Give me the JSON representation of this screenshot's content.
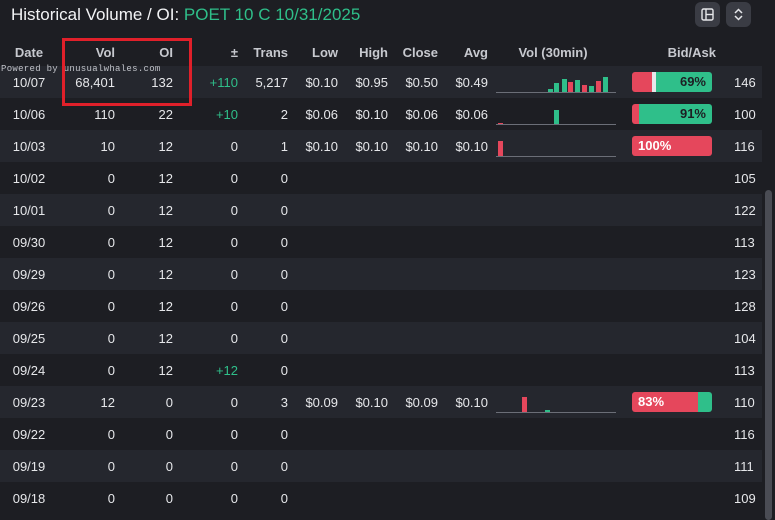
{
  "header": {
    "title_prefix": "Historical Volume / OI: ",
    "title_contract": "POET 10 C 10/31/2025",
    "buttons": [
      "columns-icon",
      "expand-collapse-icon"
    ]
  },
  "watermark": "Powered by unusualwhales.com",
  "columns": [
    "Date",
    "Vol",
    "OI",
    "±",
    "Trans",
    "Low",
    "High",
    "Close",
    "Avg",
    "Vol (30min)",
    "Bid/Ask",
    ""
  ],
  "rows": [
    {
      "date": "10/07",
      "vol": "68,401",
      "oi": "132",
      "chg": "+110",
      "trans": "5,217",
      "low": "$0.10",
      "high": "$0.95",
      "close": "$0.50",
      "avg": "$0.49",
      "spark": [
        {
          "pos": 0.45,
          "h": 0.12,
          "c": "g"
        },
        {
          "pos": 0.5,
          "h": 0.45,
          "c": "g"
        },
        {
          "pos": 0.57,
          "h": 0.65,
          "c": "g"
        },
        {
          "pos": 0.63,
          "h": 0.5,
          "c": "rd"
        },
        {
          "pos": 0.69,
          "h": 0.6,
          "c": "g"
        },
        {
          "pos": 0.75,
          "h": 0.35,
          "c": "rd"
        },
        {
          "pos": 0.81,
          "h": 0.3,
          "c": "g"
        },
        {
          "pos": 0.87,
          "h": 0.55,
          "c": "rd"
        },
        {
          "pos": 0.93,
          "h": 0.75,
          "c": "g"
        }
      ],
      "bid": 0.25,
      "mid": 0.05,
      "ask": 0.7,
      "label": "69%",
      "label_side": "ask",
      "extra": "146"
    },
    {
      "date": "10/06",
      "vol": "110",
      "oi": "22",
      "chg": "+10",
      "trans": "2",
      "low": "$0.06",
      "high": "$0.10",
      "close": "$0.06",
      "avg": "$0.06",
      "spark": [
        {
          "pos": 0.02,
          "h": 0.05,
          "c": "rd"
        },
        {
          "pos": 0.5,
          "h": 0.7,
          "c": "g"
        }
      ],
      "bid": 0.09,
      "mid": 0.0,
      "ask": 0.91,
      "label": "91%",
      "label_side": "ask",
      "extra": "100"
    },
    {
      "date": "10/03",
      "vol": "10",
      "oi": "12",
      "chg": "0",
      "trans": "1",
      "low": "$0.10",
      "high": "$0.10",
      "close": "$0.10",
      "avg": "$0.10",
      "spark": [
        {
          "pos": 0.02,
          "h": 0.75,
          "c": "rd"
        }
      ],
      "bid": 1.0,
      "mid": 0.0,
      "ask": 0.0,
      "label": "100%",
      "label_side": "bid",
      "extra": "116"
    },
    {
      "date": "10/02",
      "vol": "0",
      "oi": "12",
      "chg": "0",
      "trans": "0",
      "low": "",
      "high": "",
      "close": "",
      "avg": "",
      "spark": [],
      "bid": 0,
      "mid": 0,
      "ask": 0,
      "label": "",
      "label_side": "",
      "extra": "105"
    },
    {
      "date": "10/01",
      "vol": "0",
      "oi": "12",
      "chg": "0",
      "trans": "0",
      "low": "",
      "high": "",
      "close": "",
      "avg": "",
      "spark": [],
      "bid": 0,
      "mid": 0,
      "ask": 0,
      "label": "",
      "label_side": "",
      "extra": "122"
    },
    {
      "date": "09/30",
      "vol": "0",
      "oi": "12",
      "chg": "0",
      "trans": "0",
      "low": "",
      "high": "",
      "close": "",
      "avg": "",
      "spark": [],
      "bid": 0,
      "mid": 0,
      "ask": 0,
      "label": "",
      "label_side": "",
      "extra": "113"
    },
    {
      "date": "09/29",
      "vol": "0",
      "oi": "12",
      "chg": "0",
      "trans": "0",
      "low": "",
      "high": "",
      "close": "",
      "avg": "",
      "spark": [],
      "bid": 0,
      "mid": 0,
      "ask": 0,
      "label": "",
      "label_side": "",
      "extra": "123"
    },
    {
      "date": "09/26",
      "vol": "0",
      "oi": "12",
      "chg": "0",
      "trans": "0",
      "low": "",
      "high": "",
      "close": "",
      "avg": "",
      "spark": [],
      "bid": 0,
      "mid": 0,
      "ask": 0,
      "label": "",
      "label_side": "",
      "extra": "128"
    },
    {
      "date": "09/25",
      "vol": "0",
      "oi": "12",
      "chg": "0",
      "trans": "0",
      "low": "",
      "high": "",
      "close": "",
      "avg": "",
      "spark": [],
      "bid": 0,
      "mid": 0,
      "ask": 0,
      "label": "",
      "label_side": "",
      "extra": "104"
    },
    {
      "date": "09/24",
      "vol": "0",
      "oi": "12",
      "chg": "+12",
      "trans": "0",
      "low": "",
      "high": "",
      "close": "",
      "avg": "",
      "spark": [],
      "bid": 0,
      "mid": 0,
      "ask": 0,
      "label": "",
      "label_side": "",
      "extra": "113"
    },
    {
      "date": "09/23",
      "vol": "12",
      "oi": "0",
      "chg": "0",
      "trans": "3",
      "low": "$0.09",
      "high": "$0.10",
      "close": "$0.09",
      "avg": "$0.10",
      "spark": [
        {
          "pos": 0.23,
          "h": 0.75,
          "c": "rd"
        },
        {
          "pos": 0.43,
          "h": 0.1,
          "c": "g"
        }
      ],
      "bid": 0.83,
      "mid": 0.0,
      "ask": 0.17,
      "label": "83%",
      "label_side": "bid",
      "extra": "110"
    },
    {
      "date": "09/22",
      "vol": "0",
      "oi": "0",
      "chg": "0",
      "trans": "0",
      "low": "",
      "high": "",
      "close": "",
      "avg": "",
      "spark": [],
      "bid": 0,
      "mid": 0,
      "ask": 0,
      "label": "",
      "label_side": "",
      "extra": "116"
    },
    {
      "date": "09/19",
      "vol": "0",
      "oi": "0",
      "chg": "0",
      "trans": "0",
      "low": "",
      "high": "",
      "close": "",
      "avg": "",
      "spark": [],
      "bid": 0,
      "mid": 0,
      "ask": 0,
      "label": "",
      "label_side": "",
      "extra": "111"
    },
    {
      "date": "09/18",
      "vol": "0",
      "oi": "0",
      "chg": "0",
      "trans": "0",
      "low": "",
      "high": "",
      "close": "",
      "avg": "",
      "spark": [],
      "bid": 0,
      "mid": 0,
      "ask": 0,
      "label": "",
      "label_side": "",
      "extra": "109"
    }
  ],
  "colors": {
    "bid": "#e5475c",
    "ask": "#2fbf8a",
    "mid": "#e6e7ea",
    "accent": "#2fbf8a",
    "highlight": "#e0202a"
  }
}
